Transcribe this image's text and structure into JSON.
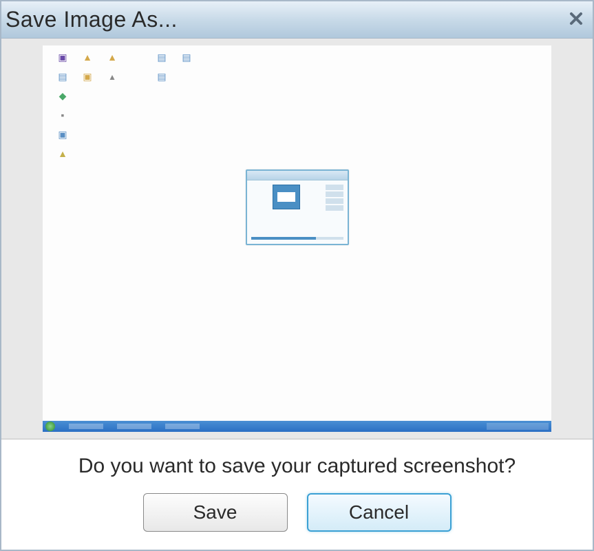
{
  "titlebar": {
    "title": "Save Image As..."
  },
  "prompt": {
    "text": "Do you want to save your captured screenshot?"
  },
  "buttons": {
    "save": "Save",
    "cancel": "Cancel"
  }
}
